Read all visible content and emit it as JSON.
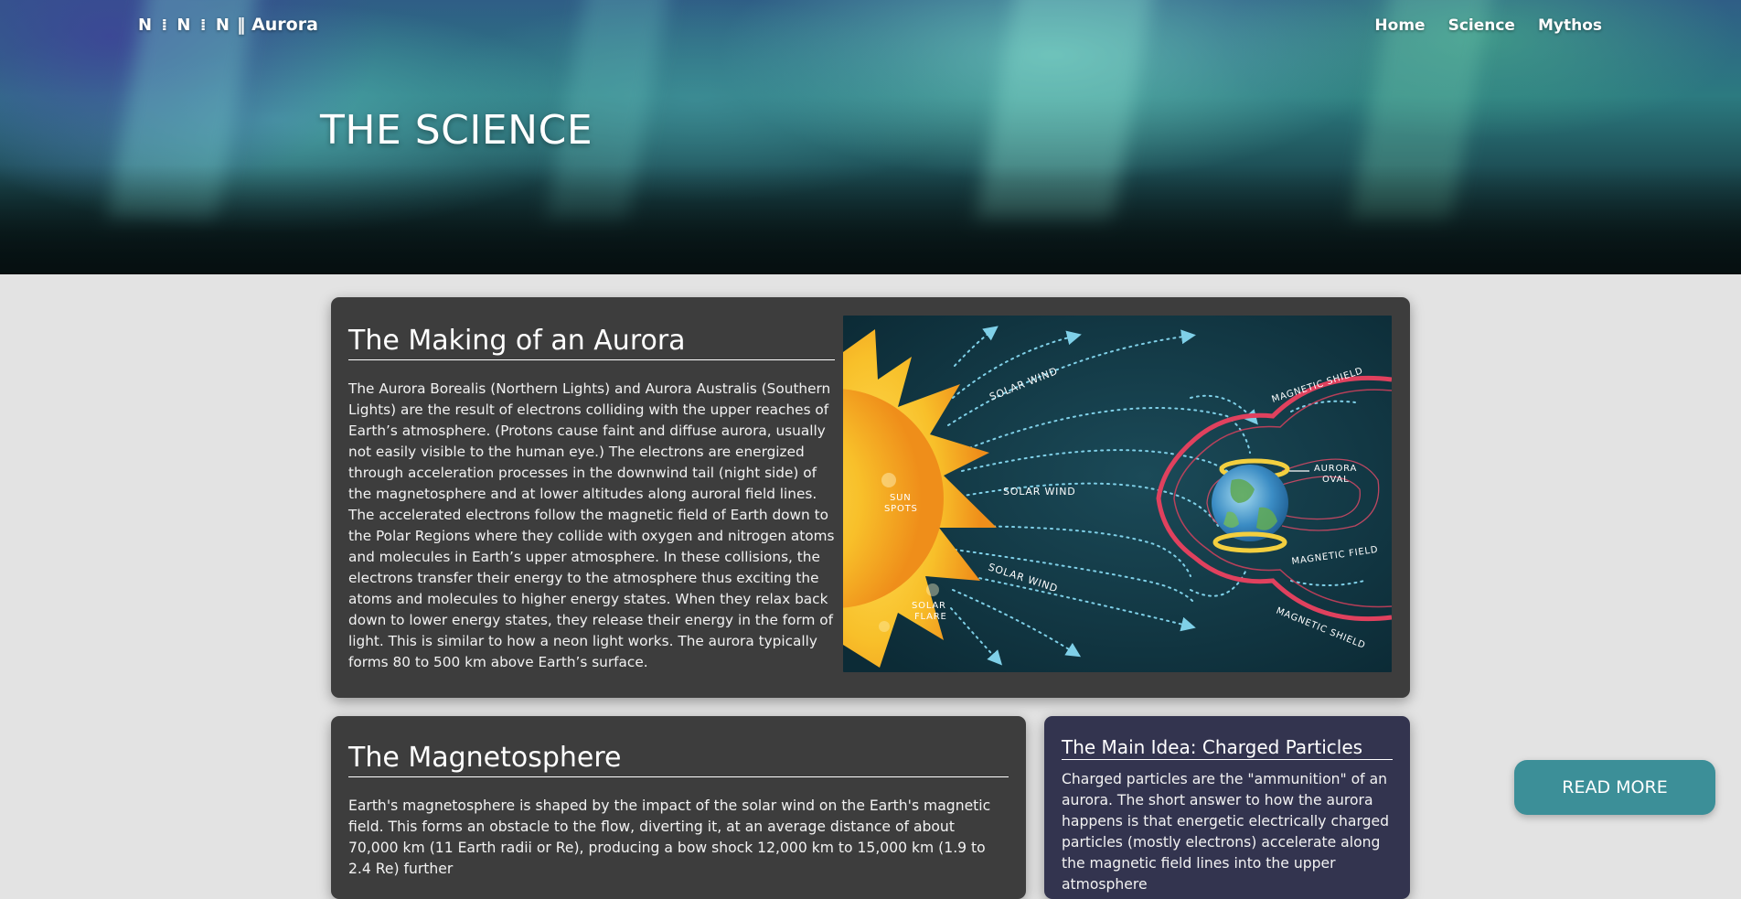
{
  "header": {
    "logo_mark": "N ⁞ N ⁞ N",
    "brand_separator": "‖",
    "brand_name": "Aurora",
    "nav": [
      {
        "label": "Home"
      },
      {
        "label": "Science"
      },
      {
        "label": "Mythos"
      }
    ]
  },
  "hero": {
    "title": "THE SCIENCE"
  },
  "making": {
    "title": "The Making of an Aurora",
    "body": "The Aurora Borealis (Northern Lights) and Aurora Australis (Southern Lights) are the result of electrons colliding with the upper reaches of Earth’s atmosphere. (Protons cause faint and diffuse aurora, usually not easily visible to the human eye.) The electrons are energized through acceleration processes in the downwind tail (night side) of the magnetosphere and at lower altitudes along auroral field lines. The accelerated electrons follow the magnetic field of Earth down to the Polar Regions where they collide with oxygen and nitrogen atoms and molecules in Earth’s upper atmosphere. In these collisions, the electrons transfer their energy to the atmosphere thus exciting the atoms and molecules to higher energy states. When they relax back down to lower energy states, they release their energy in the form of light. This is similar to how a neon light works. The aurora typically forms 80 to 500 km above Earth’s surface.",
    "diagram": {
      "labels": {
        "solar_wind_top": "SOLAR WIND",
        "solar_wind_mid": "SOLAR WIND",
        "solar_wind_bottom": "SOLAR WIND",
        "sun_spots_1": "SUN",
        "sun_spots_2": "SPOTS",
        "solar_flare_1": "SOLAR",
        "solar_flare_2": "FLARE",
        "magnetic_shield_top": "MAGNETIC SHIELD",
        "magnetic_shield_bottom": "MAGNETIC SHIELD",
        "aurora_oval_1": "AURORA",
        "aurora_oval_2": "OVAL",
        "magnetic_field": "MAGNETIC FIELD"
      },
      "colors": {
        "background": "#123a47",
        "sun": "#f6b21c",
        "shield": "#e0415e",
        "wind": "#7fd0e8",
        "oval": "#f3cf3f"
      }
    }
  },
  "magneto": {
    "title": "The Magnetosphere",
    "body": "Earth's magnetosphere is shaped by the impact of the solar wind on the Earth's magnetic field. This forms an obstacle to the flow, diverting it, at an average distance of about 70,000 km (11 Earth radii or Re), producing a bow shock 12,000 km to 15,000 km (1.9 to 2.4 Re) further"
  },
  "main_idea": {
    "title": "The Main Idea: Charged Particles",
    "body": "Charged particles are the \"ammunition\" of an aurora. The short answer to how the aurora happens is that energetic electrically charged particles (mostly electrons) accelerate along the magnetic field lines into the upper atmosphere"
  },
  "cta": {
    "label": "READ MORE"
  }
}
